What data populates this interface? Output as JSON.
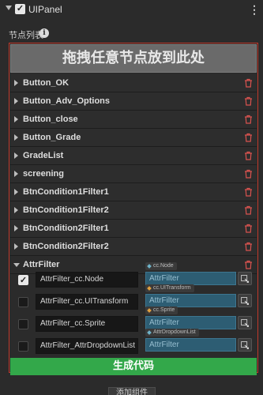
{
  "header": {
    "title": "UIPanel",
    "enabled": true
  },
  "node_list": {
    "label": "节点列表",
    "dropzone_text": "拖拽任意节点放到此处",
    "items": [
      {
        "label": "Button_OK"
      },
      {
        "label": "Button_Adv_Options"
      },
      {
        "label": "Button_close"
      },
      {
        "label": "Button_Grade"
      },
      {
        "label": "GradeList"
      },
      {
        "label": "screening"
      },
      {
        "label": "BtnCondition1Filter1"
      },
      {
        "label": "BtnCondition1Filter2"
      },
      {
        "label": "BtnCondition2Filter1"
      },
      {
        "label": "BtnCondition2Filter2"
      }
    ],
    "expanded_item": {
      "label": "AttrFilter",
      "components": [
        {
          "checked": true,
          "name": "AttrFilter_cc.Node",
          "type_tag": "cc.Node",
          "value": "AttrFilter"
        },
        {
          "checked": false,
          "name": "AttrFilter_cc.UITransform",
          "type_tag": "cc.UITransform",
          "value": "AttrFilter"
        },
        {
          "checked": false,
          "name": "AttrFilter_cc.Sprite",
          "type_tag": "cc.Sprite",
          "value": "AttrFilter"
        },
        {
          "checked": false,
          "name": "AttrFilter_AttrDropdownList",
          "type_tag": "AttrDropdownList",
          "value": "AttrFilter"
        }
      ]
    }
  },
  "actions": {
    "generate_label": "生成代码",
    "add_component_label": "添加组件"
  },
  "colors": {
    "background": "#2b2b2b",
    "panel_border": "#c0392b",
    "generate_button": "#33a84a",
    "delete_icon": "#d9534f",
    "attr_field": "#2d5d73"
  }
}
